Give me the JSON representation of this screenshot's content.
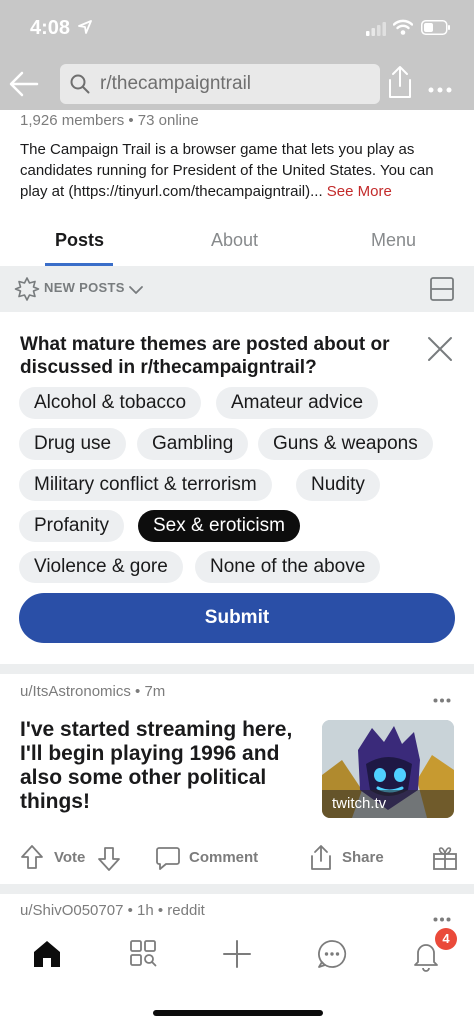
{
  "status_bar": {
    "time": "4:08",
    "icons": [
      "location-arrow-icon",
      "cellular-signal-icon",
      "wifi-icon",
      "battery-icon"
    ]
  },
  "header": {
    "search_text": "r/thecampaigntrail",
    "icons": [
      "back-arrow-icon",
      "search-icon",
      "share-icon",
      "more-icon"
    ]
  },
  "community": {
    "stats": "1,926 members • 73 online",
    "description": "The Campaign Trail is a browser game that lets you play as candidates running for President of the United States. You can play at (https://tinyurl.com/thecampaigntrail)...",
    "see_more": "See More"
  },
  "tabs": [
    {
      "label": "Posts",
      "active": true
    },
    {
      "label": "About",
      "active": false
    },
    {
      "label": "Menu",
      "active": false
    }
  ],
  "sort": {
    "label": "NEW POSTS",
    "icons": [
      "sparkle-icon",
      "chevron-down-icon",
      "card-layout-icon"
    ]
  },
  "survey": {
    "question": "What mature themes are posted about or discussed in r/thecampaigntrail?",
    "options": [
      {
        "label": "Alcohol & tobacco",
        "selected": false
      },
      {
        "label": "Amateur advice",
        "selected": false
      },
      {
        "label": "Drug use",
        "selected": false
      },
      {
        "label": "Gambling",
        "selected": false
      },
      {
        "label": "Guns & weapons",
        "selected": false
      },
      {
        "label": "Military conflict & terrorism",
        "selected": false
      },
      {
        "label": "Nudity",
        "selected": false
      },
      {
        "label": "Profanity",
        "selected": false
      },
      {
        "label": "Sex & eroticism",
        "selected": true
      },
      {
        "label": "Violence & gore",
        "selected": false
      },
      {
        "label": "None of the above",
        "selected": false
      }
    ],
    "submit_label": "Submit",
    "accent_color": "#2a4fa7"
  },
  "posts": [
    {
      "author": "u/ItsAstronomics",
      "age": "7m",
      "title": "I've started streaming here, I'll begin playing 1996 and also some other political things!",
      "thumbnail_domain": "twitch.tv",
      "vote_label": "Vote",
      "comment_label": "Comment",
      "share_label": "Share"
    },
    {
      "author": "u/ShivO050707",
      "age": "1h",
      "source": "reddit"
    }
  ],
  "bottom_nav": {
    "items": [
      "home-icon",
      "discover-icon",
      "create-icon",
      "chat-icon",
      "notifications-icon"
    ],
    "notification_count": "4"
  }
}
